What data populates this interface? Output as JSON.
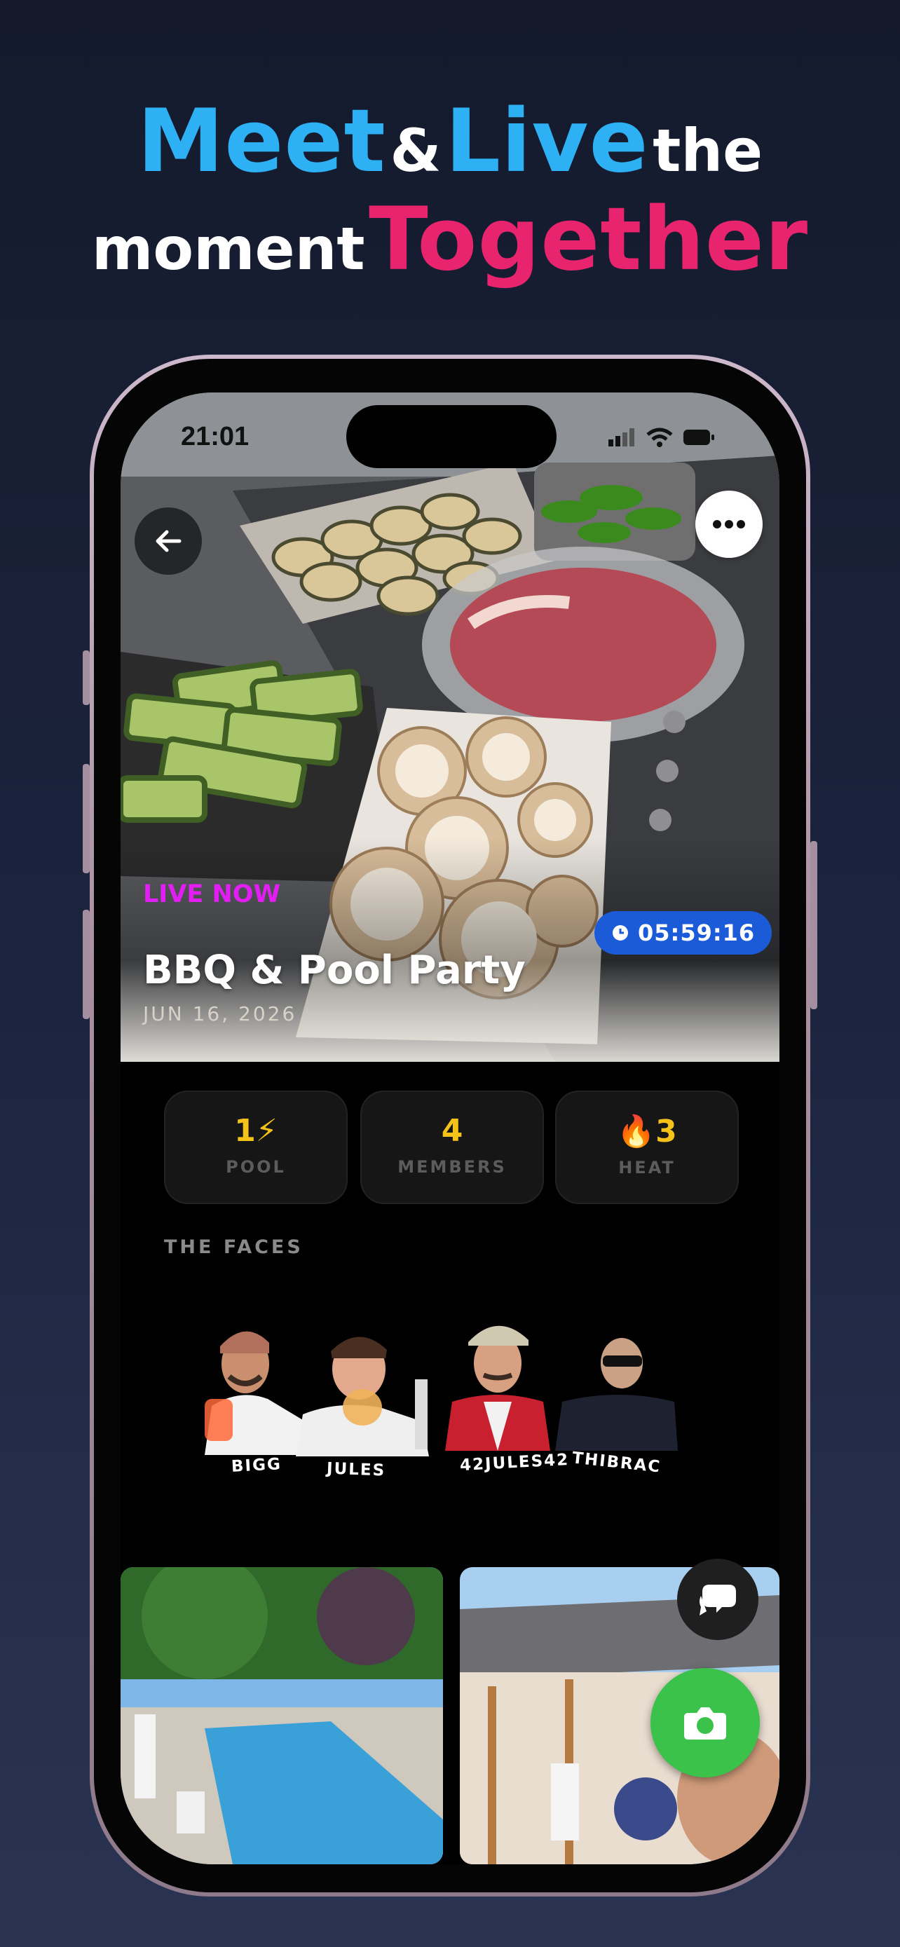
{
  "headline": {
    "line1_meet": "Meet",
    "line1_and": "&",
    "line1_live": "Live",
    "line1_the": "the",
    "line2_moment": "moment",
    "line2_together": "Together"
  },
  "status_bar": {
    "time": "21:01"
  },
  "event": {
    "live_label": "LIVE NOW",
    "timer": "05:59:16",
    "title": "BBQ & Pool Party",
    "date": "JUN 16, 2026"
  },
  "stats": [
    {
      "value": "1⚡",
      "label": "POOL"
    },
    {
      "value": "4",
      "label": "MEMBERS"
    },
    {
      "value": "🔥3",
      "label": "HEAT"
    }
  ],
  "faces": {
    "heading": "THE FACES",
    "people": [
      "BIGG",
      "JULES",
      "42JULES42",
      "THIBRAC"
    ]
  },
  "icons": {
    "back": "arrow-left-icon",
    "more": "ellipsis-icon",
    "timer": "clock-icon",
    "chat": "chat-bubbles-icon",
    "camera": "camera-icon"
  },
  "colors": {
    "meet_live": "#2eb0f5",
    "together": "#e8246e",
    "live_now": "#e21ef5",
    "timer_bg": "#1c5bd8",
    "stat_value": "#f5c21a",
    "camera_button": "#3ac24a"
  }
}
